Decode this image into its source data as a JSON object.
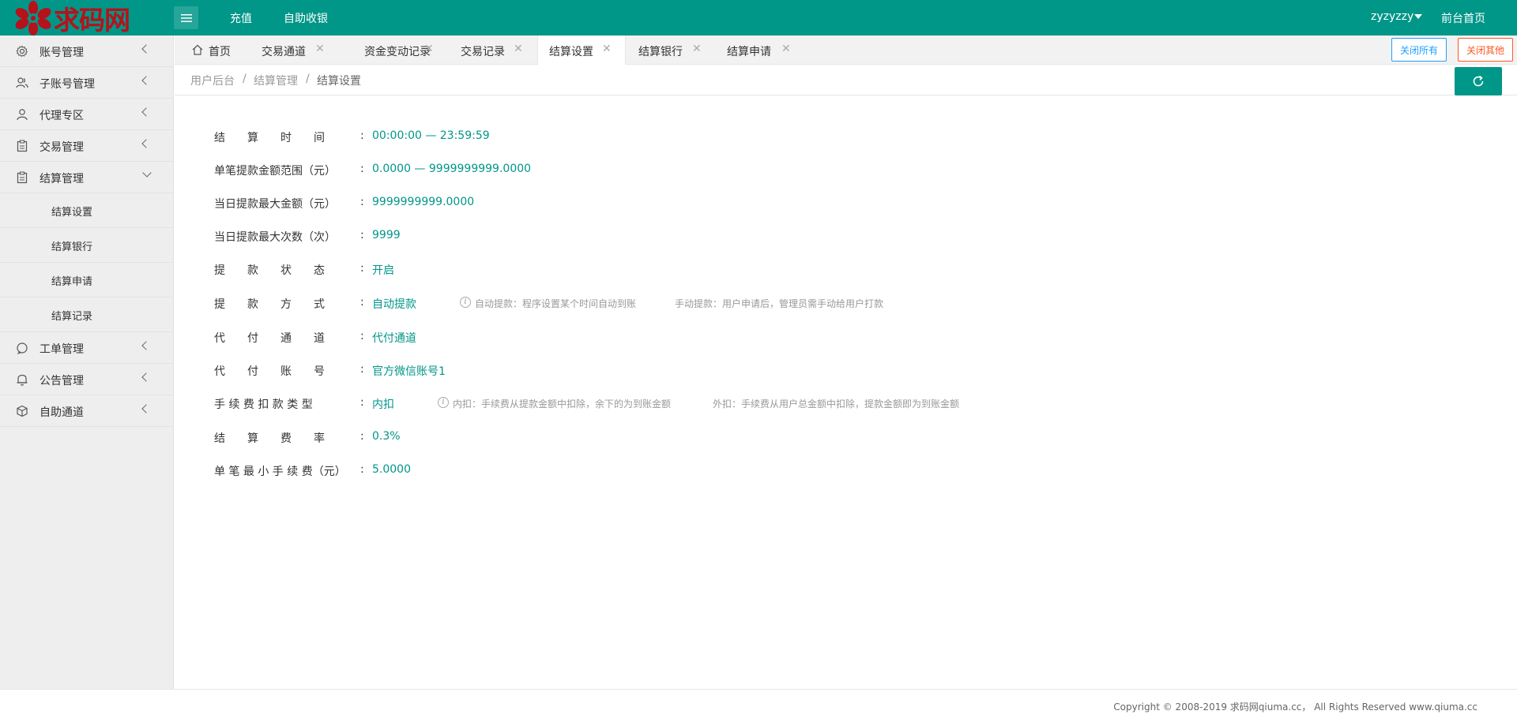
{
  "header": {
    "logo_text": "求码网",
    "links": [
      "充值",
      "自助收银"
    ],
    "user": "zyzyzzy",
    "front_link": "前台首页",
    "accent": "#009688"
  },
  "sidebar": {
    "items": [
      {
        "label": "账号管理",
        "icon": "gear-icon"
      },
      {
        "label": "子账号管理",
        "icon": "users-icon"
      },
      {
        "label": "代理专区",
        "icon": "user-icon"
      },
      {
        "label": "交易管理",
        "icon": "clipboard-icon"
      },
      {
        "label": "结算管理",
        "icon": "clipboard-icon",
        "expanded": true
      }
    ],
    "sub_items": [
      "结算设置",
      "结算银行",
      "结算申请",
      "结算记录"
    ],
    "items_after": [
      {
        "label": "工单管理",
        "icon": "chat-icon"
      },
      {
        "label": "公告管理",
        "icon": "bell-icon"
      },
      {
        "label": "自助通道",
        "icon": "cube-icon"
      }
    ]
  },
  "tabs": {
    "home": "首页",
    "items": [
      "交易通道",
      "资金变动记录",
      "交易记录",
      "结算设置",
      "结算银行",
      "结算申请"
    ],
    "active": "结算设置",
    "close_all": "关闭所有",
    "close_others": "关闭其他"
  },
  "breadcrumb": [
    "用户后台",
    "结算管理",
    "结算设置"
  ],
  "settings": {
    "time": {
      "label": "结　　算　　时　　间",
      "value": "00:00:00 — 23:59:59"
    },
    "range": {
      "label": "单笔提款金额范围（元）",
      "value": "0.0000 — 9999999999.0000"
    },
    "daily_max": {
      "label": "当日提款最大金额（元）",
      "value": "9999999999.0000"
    },
    "daily_count": {
      "label": "当日提款最大次数（次）",
      "value": "9999"
    },
    "status": {
      "label": "提　　款　　状　　态",
      "value": "开启"
    },
    "method": {
      "label": "提　　款　　方　　式",
      "value": "自动提款",
      "hint1": "自动提款：程序设置某个时间自动到账",
      "hint2": "手动提款：用户申请后，管理员需手动给用户打款"
    },
    "channel": {
      "label": "代　　付　　通　　道",
      "value": "代付通道"
    },
    "account": {
      "label": "代　　付　　账　　号",
      "value": "官方微信账号1"
    },
    "fee_type": {
      "label": "手 续 费 扣 款 类 型",
      "value": "内扣",
      "hint1": "内扣：手续费从提款金额中扣除，余下的为到账金额",
      "hint2": "外扣：手续费从用户总金额中扣除，提款金额即为到账金额"
    },
    "fee_rate": {
      "label": "结　　算　　费　　率",
      "value": "0.3%"
    },
    "min_fee": {
      "label": "单 笔 最 小 手 续 费（元）",
      "value": "5.0000"
    }
  },
  "footer": {
    "text": "Copyright © 2008-2019 求码网qiuma.cc， All Rights Reserved www.qiuma.cc"
  }
}
